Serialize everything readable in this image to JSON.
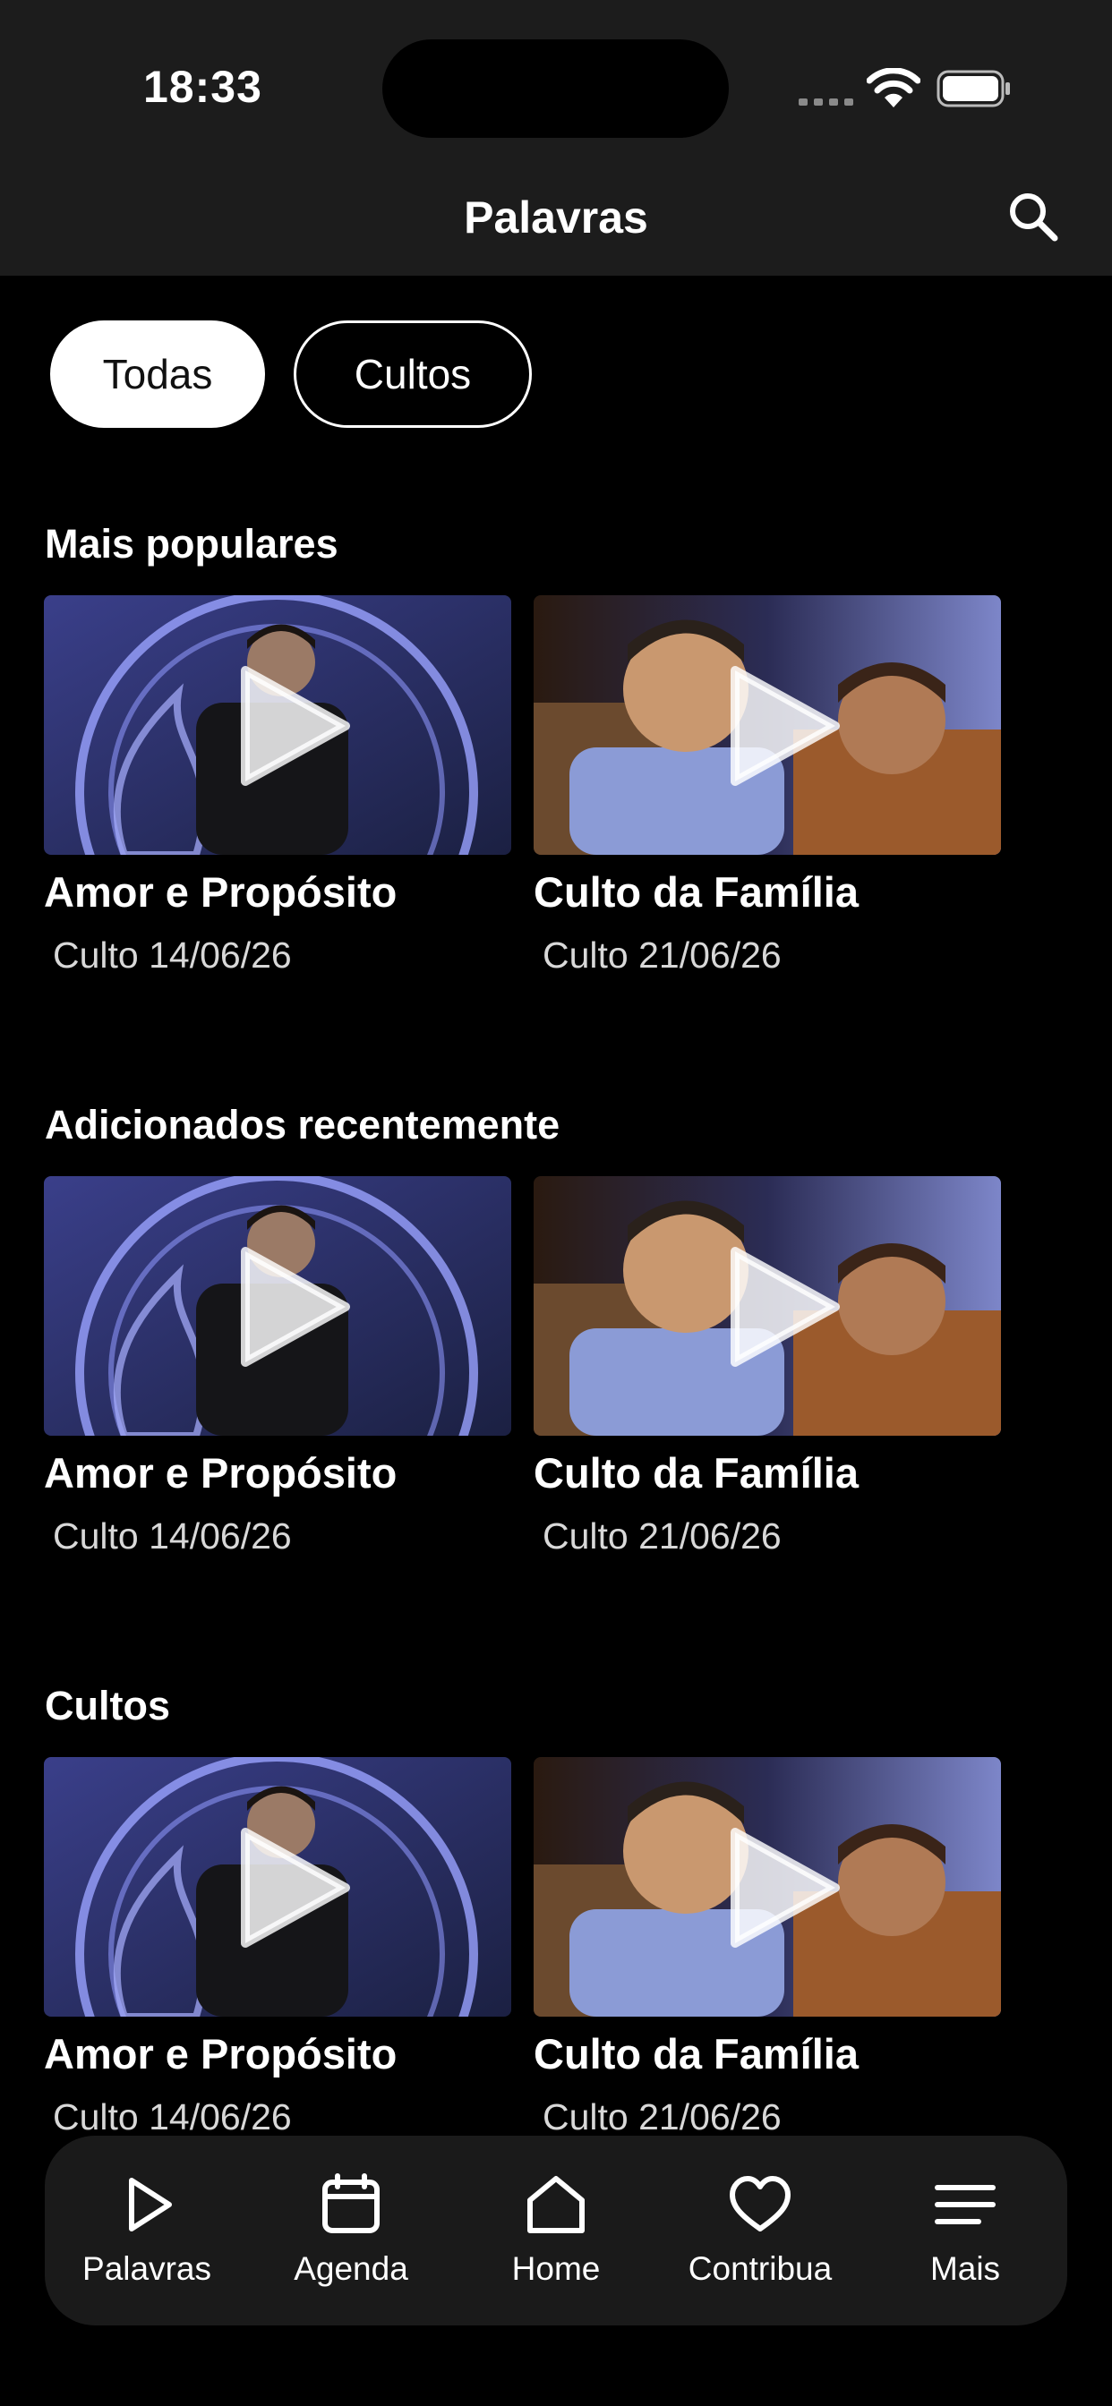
{
  "status_bar": {
    "time": "18:33"
  },
  "header": {
    "title": "Palavras",
    "search_icon": "search-icon"
  },
  "filters": [
    {
      "label": "Todas",
      "selected": true
    },
    {
      "label": "Cultos",
      "selected": false
    }
  ],
  "sections": [
    {
      "title": "Mais populares",
      "items": [
        {
          "title": "Amor e Propósito",
          "subtitle": "Culto 14/06/26"
        },
        {
          "title": "Culto da Família",
          "subtitle": "Culto 21/06/26"
        }
      ]
    },
    {
      "title": "Adicionados recentemente",
      "items": [
        {
          "title": "Amor e Propósito",
          "subtitle": "Culto 14/06/26"
        },
        {
          "title": "Culto da Família",
          "subtitle": "Culto 21/06/26"
        }
      ]
    },
    {
      "title": "Cultos",
      "items": [
        {
          "title": "Amor e Propósito",
          "subtitle": "Culto 14/06/26"
        },
        {
          "title": "Culto da Família",
          "subtitle": "Culto 21/06/26"
        }
      ]
    }
  ],
  "tab_bar": [
    {
      "label": "Palavras",
      "icon": "play-icon"
    },
    {
      "label": "Agenda",
      "icon": "calendar-icon"
    },
    {
      "label": "Home",
      "icon": "home-icon"
    },
    {
      "label": "Contribua",
      "icon": "heart-icon"
    },
    {
      "label": "Mais",
      "icon": "menu-icon"
    }
  ],
  "colors": {
    "background": "#000000",
    "bar": "#1c1c1c",
    "text": "#ffffff",
    "subtext": "#d8d8d8"
  }
}
